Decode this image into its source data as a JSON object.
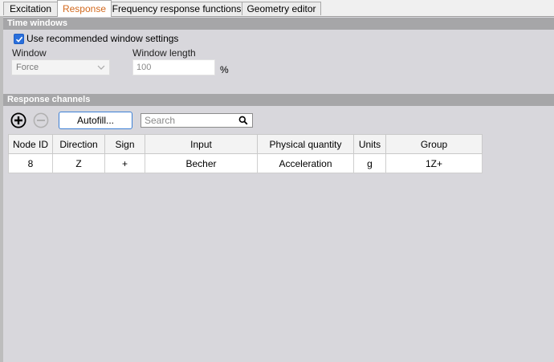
{
  "tabs": [
    {
      "label": "Excitation",
      "active": false
    },
    {
      "label": "Response",
      "active": true
    },
    {
      "label": "Frequency response functions",
      "active": false
    },
    {
      "label": "Geometry editor",
      "active": false
    }
  ],
  "time_windows": {
    "header": "Time windows",
    "use_recommended_label": "Use recommended window settings",
    "use_recommended_checked": true,
    "window_label": "Window",
    "window_value": "Force",
    "window_length_label": "Window length",
    "window_length_value": "100",
    "window_length_unit": "%"
  },
  "response_channels": {
    "header": "Response channels",
    "autofill_label": "Autofill...",
    "search_placeholder": "Search",
    "columns": [
      "Node ID",
      "Direction",
      "Sign",
      "Input",
      "Physical quantity",
      "Units",
      "Group"
    ],
    "rows": [
      [
        "8",
        "Z",
        "+",
        "Becher",
        "Acceleration",
        "g",
        "1Z+"
      ]
    ]
  },
  "colors": {
    "accent_tab": "#d2691e",
    "section_header": "#a6a6a8",
    "checkbox": "#2a6fdb",
    "background": "#d8d7dc"
  }
}
